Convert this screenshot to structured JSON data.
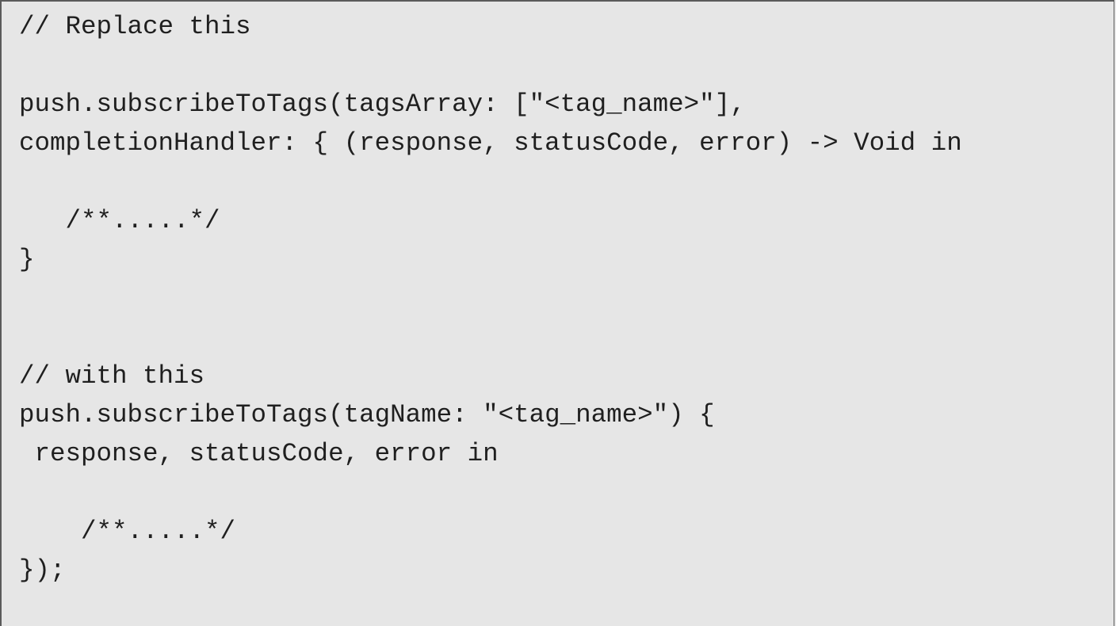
{
  "code": {
    "lines": [
      "// Replace this",
      "",
      "push.subscribeToTags(tagsArray: [\"<tag_name>\"],",
      "completionHandler: { (response, statusCode, error) -> Void in",
      "",
      "   /**.....*/",
      "}",
      "",
      "",
      "// with this",
      "push.subscribeToTags(tagName: \"<tag_name>\") {",
      " response, statusCode, error in",
      "",
      "    /**.....*/",
      "});"
    ]
  }
}
